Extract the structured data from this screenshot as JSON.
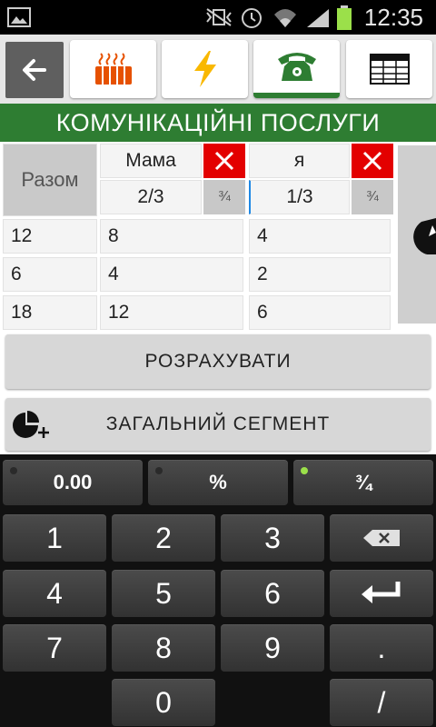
{
  "status_bar": {
    "time": "12:35"
  },
  "toolbar": {
    "back_icon": "arrow-left-icon",
    "tabs": [
      {
        "icon": "radiator-icon"
      },
      {
        "icon": "lightning-icon"
      },
      {
        "icon": "telephone-icon",
        "active": true
      },
      {
        "icon": "table-icon"
      }
    ]
  },
  "title": "КОМУНІКАЦІЙНІ ПОСЛУГИ",
  "table": {
    "razom_label": "Разом",
    "columns": [
      {
        "name": "Мама",
        "share": "2/3",
        "fraction_btn": "¾"
      },
      {
        "name": "я",
        "share": "1/3",
        "fraction_btn": "¾"
      }
    ],
    "rows": [
      {
        "total": "12",
        "values": [
          "8",
          "4"
        ]
      },
      {
        "total": "6",
        "values": [
          "4",
          "2"
        ]
      },
      {
        "total": "18",
        "values": [
          "12",
          "6"
        ]
      }
    ]
  },
  "buttons": {
    "calculate": "РОЗРАХУВАТИ",
    "general_segment": "ЗАГАЛЬНИЙ СЕГМЕНТ"
  },
  "keyboard": {
    "top_row": [
      "0.00",
      "%",
      "¾"
    ],
    "rows": [
      [
        "1",
        "2",
        "3",
        "⌫"
      ],
      [
        "4",
        "5",
        "6",
        "↵"
      ],
      [
        "7",
        "8",
        "9",
        "."
      ],
      [
        "",
        "0",
        "",
        "/"
      ]
    ]
  },
  "colors": {
    "accent_green": "#2e7d32",
    "delete_red": "#e30000"
  }
}
